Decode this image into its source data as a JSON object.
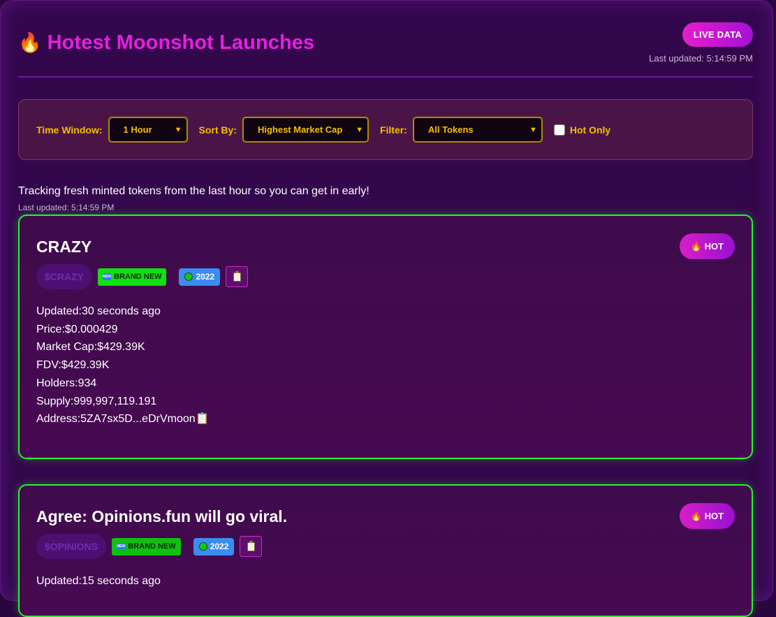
{
  "header": {
    "flame_emoji": "🔥",
    "title": "Hotest Moonshot Launches",
    "live_button": "LIVE DATA",
    "last_updated": "Last updated: 5:14:59 PM"
  },
  "filters": {
    "time_window_label": "Time Window:",
    "time_window_value": "1 Hour",
    "sort_by_label": "Sort By:",
    "sort_by_value": "Highest Market Cap",
    "filter_label": "Filter:",
    "filter_value": "All Tokens",
    "hot_only_label": "Hot Only",
    "hot_only_checked": false
  },
  "tagline": "Tracking fresh minted tokens from the last hour so you can get in early!",
  "sub_updated": "Last updated: 5:14:59 PM",
  "tokens": [
    {
      "name": "CRAZY",
      "hot_label": "🔥 HOT",
      "ticker": "$CRAZY",
      "brand_new": "BRAND NEW",
      "year": "2022",
      "updated_label": "Updated:",
      "updated_value": "30 seconds ago",
      "price_label": "Price:",
      "price_value": "$0.000429",
      "mcap_label": "Market Cap:",
      "mcap_value": "$429.39K",
      "fdv_label": "FDV:",
      "fdv_value": "$429.39K",
      "holders_label": "Holders:",
      "holders_value": "934",
      "supply_label": "Supply:",
      "supply_value": "999,997,119.191",
      "address_label": "Address:",
      "address_value": "5ZA7sx5D...eDrVmoon📋"
    },
    {
      "name": "Agree: Opinions.fun will go viral.",
      "hot_label": "🔥 HOT",
      "ticker": "$OPINIONS",
      "brand_new": "BRAND NEW",
      "year": "2022",
      "updated_label": "Updated:",
      "updated_value": "15 seconds ago"
    }
  ],
  "colors": {
    "accent": "#e81ee0",
    "card_border": "#2bf02b",
    "filter_text": "#f0c000",
    "background": "#33074c"
  }
}
